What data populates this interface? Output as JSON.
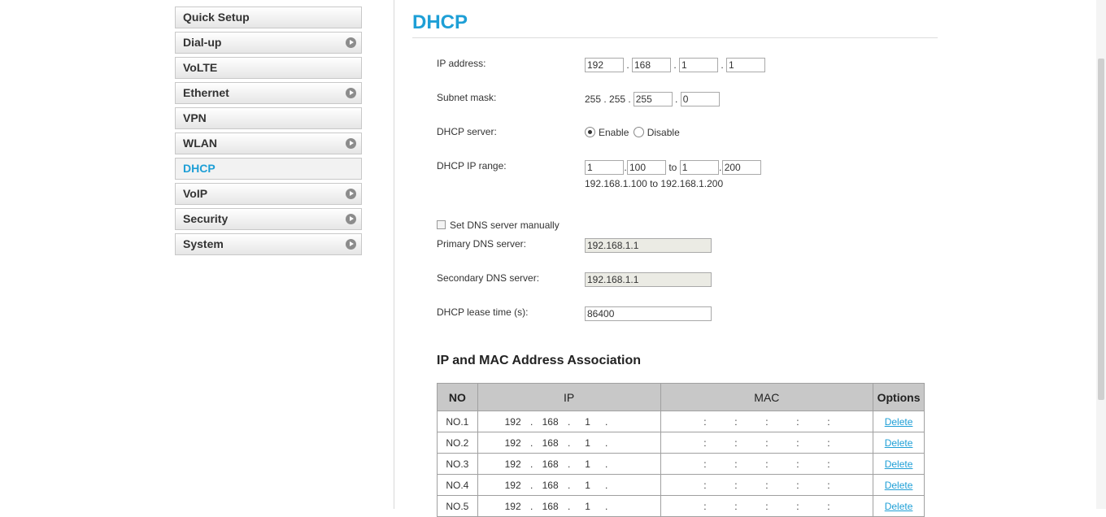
{
  "sidebar": {
    "items": [
      {
        "label": "Quick Setup",
        "arrow": false
      },
      {
        "label": "Dial-up",
        "arrow": true
      },
      {
        "label": "VoLTE",
        "arrow": false
      },
      {
        "label": "Ethernet",
        "arrow": true
      },
      {
        "label": "VPN",
        "arrow": false
      },
      {
        "label": "WLAN",
        "arrow": true
      },
      {
        "label": "DHCP",
        "arrow": false,
        "active": true
      },
      {
        "label": "VoIP",
        "arrow": true
      },
      {
        "label": "Security",
        "arrow": true
      },
      {
        "label": "System",
        "arrow": true
      }
    ]
  },
  "main": {
    "title": "DHCP",
    "ip_address": {
      "label": "IP address:",
      "octets": [
        "192",
        "168",
        "1",
        "1"
      ]
    },
    "subnet_mask": {
      "label": "Subnet mask:",
      "fixed": "255 . 255 .",
      "octet3": "255",
      "octet4": "0"
    },
    "dhcp_server": {
      "label": "DHCP server:",
      "enable": "Enable",
      "disable": "Disable",
      "selected": "Enable"
    },
    "dhcp_range": {
      "label": "DHCP IP range:",
      "start1": "1",
      "start2": "100",
      "to": "to",
      "end1": "1",
      "end2": "200",
      "summary": "192.168.1.100 to 192.168.1.200"
    },
    "dns_manual": {
      "label": "Set DNS server manually",
      "checked": false
    },
    "primary_dns": {
      "label": "Primary DNS server:",
      "value": "192.168.1.1"
    },
    "secondary_dns": {
      "label": "Secondary DNS server:",
      "value": "192.168.1.1"
    },
    "lease_time": {
      "label": "DHCP lease time (s):",
      "value": "86400"
    },
    "association": {
      "title": "IP and MAC Address Association",
      "headers": {
        "no": "NO",
        "ip": "IP",
        "mac": "MAC",
        "options": "Options"
      },
      "rows": [
        {
          "no": "NO.1",
          "ip": [
            "192",
            "168",
            "1",
            ""
          ],
          "option": "Delete"
        },
        {
          "no": "NO.2",
          "ip": [
            "192",
            "168",
            "1",
            ""
          ],
          "option": "Delete"
        },
        {
          "no": "NO.3",
          "ip": [
            "192",
            "168",
            "1",
            ""
          ],
          "option": "Delete"
        },
        {
          "no": "NO.4",
          "ip": [
            "192",
            "168",
            "1",
            ""
          ],
          "option": "Delete"
        },
        {
          "no": "NO.5",
          "ip": [
            "192",
            "168",
            "1",
            ""
          ],
          "option": "Delete"
        }
      ]
    }
  },
  "colors": {
    "accent": "#1e9fd6",
    "header_bg": "#c8c8c8"
  }
}
